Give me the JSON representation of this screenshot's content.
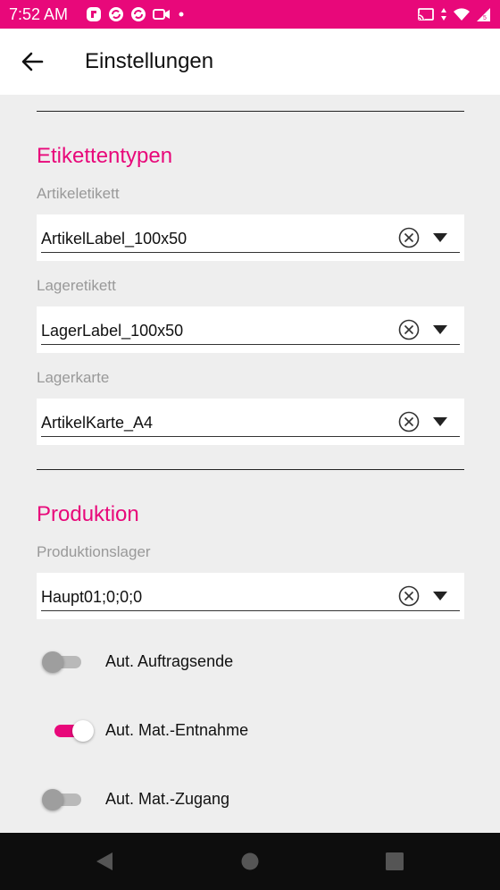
{
  "status_bar": {
    "time": "7:52 AM",
    "left_icons": [
      "flipboard-icon",
      "sync-icon",
      "sync-icon",
      "video-icon",
      "dot-icon"
    ],
    "right_icons": [
      "cast-icon",
      "data-arrows-icon",
      "wifi-icon",
      "cellular-5-icon"
    ]
  },
  "app_bar": {
    "back_icon": "arrow-left-icon",
    "title": "Einstellungen"
  },
  "colors": {
    "accent": "#e8087a",
    "background": "#eeeeee",
    "label_gray": "#999999"
  },
  "sections": [
    {
      "title": "Etikettentypen",
      "fields": [
        {
          "label": "Artikeletikett",
          "value": "ArtikelLabel_100x50"
        },
        {
          "label": "Lageretikett",
          "value": "LagerLabel_100x50"
        },
        {
          "label": "Lagerkarte",
          "value": "ArtikelKarte_A4"
        }
      ]
    },
    {
      "title": "Produktion",
      "fields": [
        {
          "label": "Produktionslager",
          "value": "Haupt01;0;0;0"
        }
      ],
      "toggles": [
        {
          "label": "Aut. Auftragsende",
          "on": false
        },
        {
          "label": "Aut. Mat.-Entnahme",
          "on": true
        },
        {
          "label": "Aut. Mat.-Zugang",
          "on": false
        }
      ]
    }
  ],
  "nav_bar": [
    "back-triangle-icon",
    "home-circle-icon",
    "recents-square-icon"
  ]
}
